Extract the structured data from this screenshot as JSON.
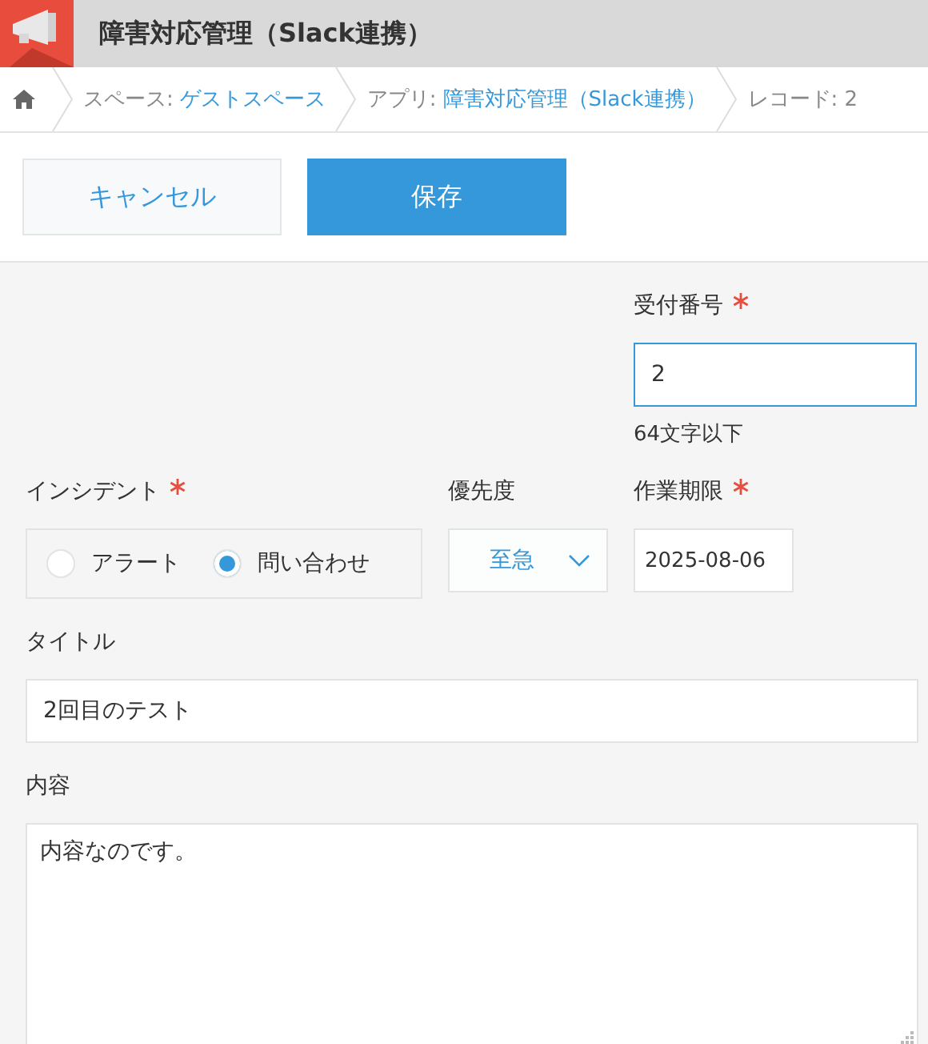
{
  "app": {
    "title": "障害対応管理（Slack連携）"
  },
  "breadcrumb": [
    {
      "prefix": "スペース:",
      "link": "ゲストスペース"
    },
    {
      "prefix": "アプリ:",
      "link": "障害対応管理（Slack連携）"
    },
    {
      "prefix": "レコード: 2"
    }
  ],
  "buttons": {
    "cancel": "キャンセル",
    "save": "保存"
  },
  "fields": {
    "receipt_number": {
      "label": "受付番号",
      "required": true,
      "value": "2",
      "hint": "64文字以下",
      "focused": true
    },
    "incident": {
      "label": "インシデント",
      "required": true,
      "options": [
        {
          "label": "アラート",
          "selected": false
        },
        {
          "label": "問い合わせ",
          "selected": true
        }
      ]
    },
    "priority": {
      "label": "優先度",
      "value": "至急"
    },
    "deadline": {
      "label": "作業期限",
      "required": true,
      "value": "2025-08-06"
    },
    "title": {
      "label": "タイトル",
      "value": "2回目のテスト"
    },
    "content": {
      "label": "内容",
      "value": "内容なのです。"
    }
  }
}
